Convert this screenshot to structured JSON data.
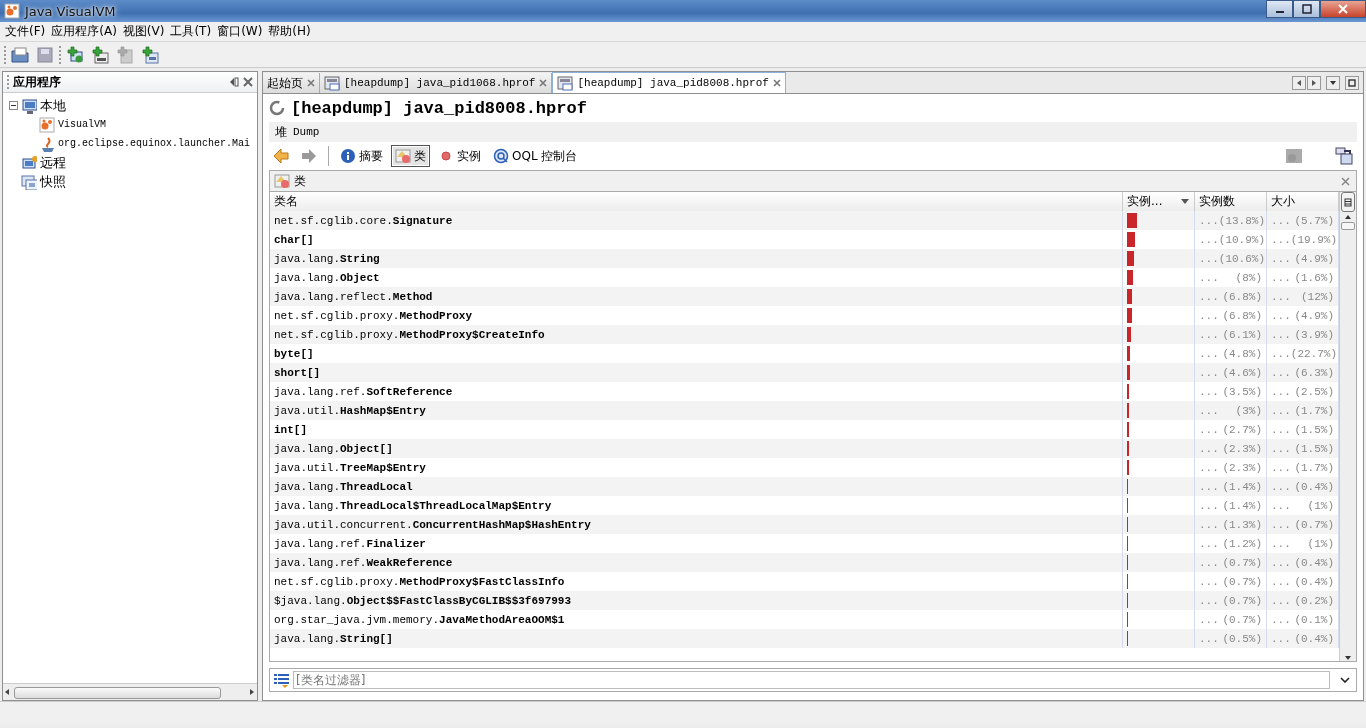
{
  "window": {
    "title": "Java VisualVM"
  },
  "menu": [
    "文件(F)",
    "应用程序(A)",
    "视图(V)",
    "工具(T)",
    "窗口(W)",
    "帮助(H)"
  ],
  "sidebar": {
    "title": "应用程序",
    "tree": [
      {
        "label": "本地",
        "kind": "local",
        "expanded": true,
        "children": [
          {
            "label": "VisualVM",
            "kind": "visualvm"
          },
          {
            "label": "org.eclipse.equinox.launcher.Mai",
            "kind": "java"
          }
        ]
      },
      {
        "label": "远程",
        "kind": "remote"
      },
      {
        "label": "快照",
        "kind": "snapshot"
      }
    ]
  },
  "tabs": [
    {
      "label": "起始页",
      "kind": "plain",
      "selected": false
    },
    {
      "label": "[heapdump] java_pid1068.hprof",
      "kind": "dump",
      "selected": false
    },
    {
      "label": "[heapdump] java_pid8008.hprof",
      "kind": "dump",
      "selected": true
    }
  ],
  "document": {
    "title": "[heapdump] java_pid8008.hprof",
    "subtab_label": "堆",
    "subtab_value": "Dump",
    "views": [
      {
        "label": "摘要",
        "kind": "info",
        "selected": false
      },
      {
        "label": "类",
        "kind": "classes",
        "selected": true
      },
      {
        "label": "实例",
        "kind": "instances",
        "selected": false
      },
      {
        "label": "OQL 控制台",
        "kind": "oql",
        "selected": false
      }
    ],
    "panel_title": "类",
    "table": {
      "columns": [
        "类名",
        "实例...",
        "实例数",
        "大小"
      ],
      "rows": [
        {
          "package": "net.sf.cglib.core.",
          "name": "Signature",
          "level": 0.138,
          "count": "...",
          "count_pct": "(13.8%)",
          "size": "...",
          "size_pct": "(5.7%)"
        },
        {
          "package": "",
          "name": "char[]",
          "level": 0.109,
          "count": "...",
          "count_pct": "(10.9%)",
          "size": "...",
          "size_pct": "(19.9%)"
        },
        {
          "package": "java.lang.",
          "name": "String",
          "level": 0.106,
          "count": "...",
          "count_pct": "(10.6%)",
          "size": "...",
          "size_pct": "(4.9%)"
        },
        {
          "package": "java.lang.",
          "name": "Object",
          "level": 0.08,
          "count": "...",
          "count_pct": "(8%)",
          "size": "...",
          "size_pct": "(1.6%)"
        },
        {
          "package": "java.lang.reflect.",
          "name": "Method",
          "level": 0.068,
          "count": "...",
          "count_pct": "(6.8%)",
          "size": "...",
          "size_pct": "(12%)"
        },
        {
          "package": "net.sf.cglib.proxy.",
          "name": "MethodProxy",
          "level": 0.068,
          "count": "...",
          "count_pct": "(6.8%)",
          "size": "...",
          "size_pct": "(4.9%)"
        },
        {
          "package": "net.sf.cglib.proxy.",
          "name": "MethodProxy$CreateInfo",
          "level": 0.061,
          "count": "...",
          "count_pct": "(6.1%)",
          "size": "...",
          "size_pct": "(3.9%)"
        },
        {
          "package": "",
          "name": "byte[]",
          "level": 0.048,
          "count": "...",
          "count_pct": "(4.8%)",
          "size": "...",
          "size_pct": "(22.7%)"
        },
        {
          "package": "",
          "name": "short[]",
          "level": 0.046,
          "count": "...",
          "count_pct": "(4.6%)",
          "size": "...",
          "size_pct": "(6.3%)"
        },
        {
          "package": "java.lang.ref.",
          "name": "SoftReference",
          "level": 0.035,
          "count": "...",
          "count_pct": "(3.5%)",
          "size": "...",
          "size_pct": "(2.5%)"
        },
        {
          "package": "java.util.",
          "name": "HashMap$Entry",
          "level": 0.03,
          "count": "...",
          "count_pct": "(3%)",
          "size": "...",
          "size_pct": "(1.7%)"
        },
        {
          "package": "",
          "name": "int[]",
          "level": 0.027,
          "count": "...",
          "count_pct": "(2.7%)",
          "size": "...",
          "size_pct": "(1.5%)"
        },
        {
          "package": "java.lang.",
          "name": "Object[]",
          "level": 0.023,
          "count": "...",
          "count_pct": "(2.3%)",
          "size": "...",
          "size_pct": "(1.5%)"
        },
        {
          "package": "java.util.",
          "name": "TreeMap$Entry",
          "level": 0.023,
          "count": "...",
          "count_pct": "(2.3%)",
          "size": "...",
          "size_pct": "(1.7%)"
        },
        {
          "package": "java.lang.",
          "name": "ThreadLocal",
          "level": 0.014,
          "count": "...",
          "count_pct": "(1.4%)",
          "size": "...",
          "size_pct": "(0.4%)"
        },
        {
          "package": "java.lang.",
          "name": "ThreadLocal$ThreadLocalMap$Entry",
          "level": 0.014,
          "count": "...",
          "count_pct": "(1.4%)",
          "size": "...",
          "size_pct": "(1%)"
        },
        {
          "package": "java.util.concurrent.",
          "name": "ConcurrentHashMap$HashEntry",
          "level": 0.013,
          "count": "...",
          "count_pct": "(1.3%)",
          "size": "...",
          "size_pct": "(0.7%)"
        },
        {
          "package": "java.lang.ref.",
          "name": "Finalizer",
          "level": 0.012,
          "count": "...",
          "count_pct": "(1.2%)",
          "size": "...",
          "size_pct": "(1%)"
        },
        {
          "package": "java.lang.ref.",
          "name": "WeakReference",
          "level": 0.007,
          "count": "...",
          "count_pct": "(0.7%)",
          "size": "...",
          "size_pct": "(0.4%)"
        },
        {
          "package": "net.sf.cglib.proxy.",
          "name": "MethodProxy$FastClassInfo",
          "level": 0.007,
          "count": "...",
          "count_pct": "(0.7%)",
          "size": "...",
          "size_pct": "(0.4%)"
        },
        {
          "package": "$java.lang.",
          "name": "Object$$FastClassByCGLIB$$3f697993",
          "level": 0.007,
          "count": "...",
          "count_pct": "(0.7%)",
          "size": "...",
          "size_pct": "(0.2%)"
        },
        {
          "package": "org.star_java.jvm.memory.",
          "name": "JavaMethodAreaOOM$1",
          "level": 0.007,
          "count": "...",
          "count_pct": "(0.7%)",
          "size": "...",
          "size_pct": "(0.1%)"
        },
        {
          "package": "java.lang.",
          "name": "String[]",
          "level": 0.005,
          "count": "...",
          "count_pct": "(0.5%)",
          "size": "...",
          "size_pct": "(0.4%)"
        }
      ]
    },
    "filter": {
      "placeholder": "[类名过滤器]"
    }
  }
}
